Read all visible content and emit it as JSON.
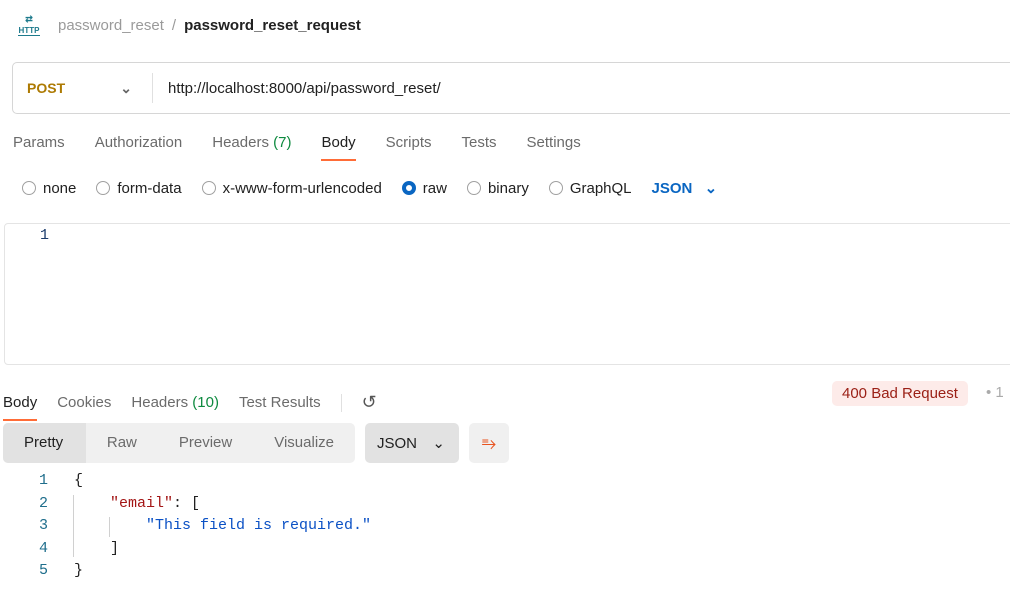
{
  "breadcrumb": {
    "icon": "HTTP",
    "collection": "password_reset",
    "request": "password_reset_request",
    "separator": "/"
  },
  "request": {
    "method": "POST",
    "url": "http://localhost:8000/api/password_reset/"
  },
  "request_tabs": [
    {
      "label": "Params"
    },
    {
      "label": "Authorization"
    },
    {
      "label": "Headers",
      "count": "(7)"
    },
    {
      "label": "Body"
    },
    {
      "label": "Scripts"
    },
    {
      "label": "Tests"
    },
    {
      "label": "Settings"
    }
  ],
  "body_types": [
    "none",
    "form-data",
    "x-www-form-urlencoded",
    "raw",
    "binary",
    "GraphQL"
  ],
  "body_format": "JSON",
  "editor": {
    "line": "1"
  },
  "response_tabs": [
    {
      "label": "Body"
    },
    {
      "label": "Cookies"
    },
    {
      "label": "Headers",
      "count": "(10)"
    },
    {
      "label": "Test Results"
    }
  ],
  "status": "400 Bad Request",
  "status_extra": "1",
  "view_modes": [
    "Pretty",
    "Raw",
    "Preview",
    "Visualize"
  ],
  "response_format": "JSON",
  "response_lines": [
    {
      "n": "1",
      "t": "{"
    },
    {
      "n": "2",
      "k": "\"email\"",
      "t": ": ["
    },
    {
      "n": "3",
      "s": "\"This field is required.\""
    },
    {
      "n": "4",
      "t": "]"
    },
    {
      "n": "5",
      "t": "}"
    }
  ]
}
